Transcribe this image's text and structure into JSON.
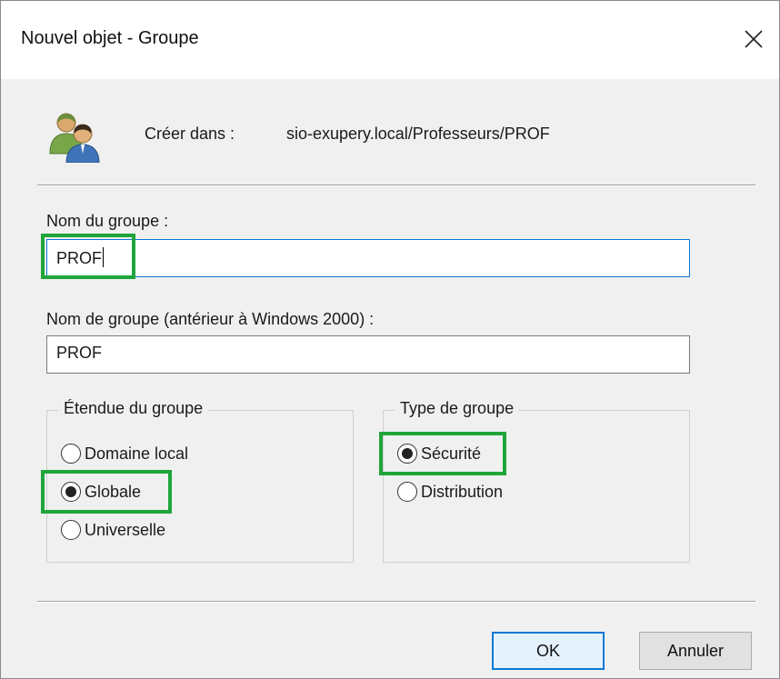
{
  "window": {
    "title": "Nouvel objet - Groupe",
    "close_glyph": "✕"
  },
  "header": {
    "icon": "users-group-icon",
    "create_label": "Créer dans :",
    "create_path": "sio-exupery.local/Professeurs/PROF"
  },
  "form": {
    "group_name_label": "Nom du groupe :",
    "group_name_value": "PROF",
    "legacy_name_label": "Nom de groupe (antérieur à Windows 2000) :",
    "legacy_name_value": "PROF"
  },
  "scope": {
    "legend": "Étendue du groupe",
    "options": [
      "Domaine local",
      "Globale",
      "Universelle"
    ],
    "selected": "Globale"
  },
  "type": {
    "legend": "Type de groupe",
    "options": [
      "Sécurité",
      "Distribution"
    ],
    "selected": "Sécurité"
  },
  "buttons": {
    "ok": "OK",
    "cancel": "Annuler"
  },
  "colors": {
    "highlight": "#1fa53a",
    "focus_accent": "#0a78d7"
  }
}
